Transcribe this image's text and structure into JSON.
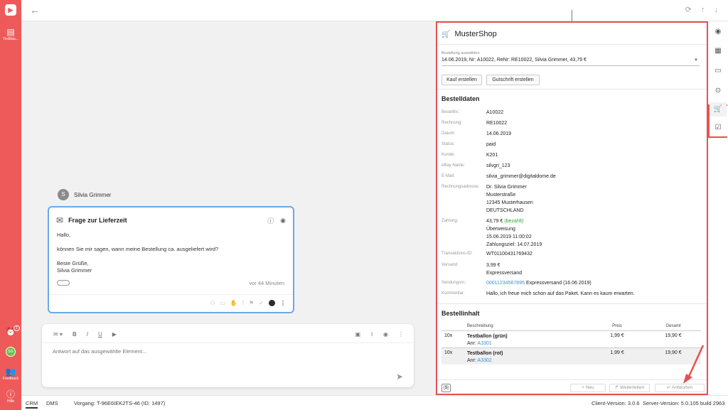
{
  "leftbar": {
    "logo": "▶",
    "textbausteine_label": "Textbau...",
    "alarm_badge": "1",
    "avatar_initials": "SG",
    "feedback_label": "Feedback",
    "help_label": "Hilfe"
  },
  "conversation": {
    "sender_initial": "S",
    "sender_name": "Silvia Grimmer",
    "message": {
      "title": "Frage zur Lieferzeit",
      "greeting": "Hallo,",
      "body": "können Sie mir sagen, wann meine Bestellung ca. ausgeliefert wird?",
      "closing": "Beste Grüße,",
      "signature": "Silvia Grimmer",
      "more": "···",
      "time": "vor 44 Minuten"
    }
  },
  "reply": {
    "placeholder": "Antwort auf das ausgewählte Element...",
    "bold": "B",
    "italic": "I",
    "underline": "U"
  },
  "shop": {
    "title": "MusterShop",
    "order_select_label": "Bestellung auswählen",
    "order_select_value": "14.06.2019, Nr: A10022, ReNr: RE10022, Silvia Grimmer, 43,79 €",
    "btn_kauf": "Kauf erstellen",
    "btn_gutschrift": "Gutschrift erstellen",
    "bestelldaten_title": "Bestelldaten",
    "fields": {
      "bestellnr_k": "Bestellnr.:",
      "bestellnr_v": "A10022",
      "rechnung_k": "Rechnung:",
      "rechnung_v": "RE10022",
      "datum_k": "Datum:",
      "datum_v": "14.06.2019",
      "status_k": "Status:",
      "status_v": "paid",
      "kunde_k": "Kunde:",
      "kunde_v": "K201",
      "ebay_k": "eBay Name:",
      "ebay_v": "silvgri_123",
      "email_k": "E-Mail:",
      "email_v": "silvia_grimmer@digitaldome.de",
      "adresse_k": "Rechnungsadresse:",
      "adresse_1": "Dr. Silvia Grimmer",
      "adresse_2": "Musterstraße",
      "adresse_3": "12345 Musterhausen",
      "adresse_4": "DEUTSCHLAND",
      "zahlung_k": "Zahlung:",
      "zahlung_betrag": "43,79 €",
      "zahlung_status": "(bezahlt)",
      "zahlung_2": "Überweisung",
      "zahlung_3": "15.06.2019 11:00:02",
      "zahlung_4": "Zahlungsziel: 14.07.2019",
      "trans_k": "Transaktions-ID:",
      "trans_v": "WT01100431769432",
      "versand_k": "Versand:",
      "versand_1": "3,99 €",
      "versand_2": "Expressversand",
      "sendung_k": "Sendungsnr.:",
      "sendung_link": "00011234567895",
      "sendung_text": "Expressversand (16.06.2019)",
      "kommentar_k": "Kommentar:",
      "kommentar_v": "Hallo, ich freue mich schon auf das Paket. Kann es kaum erwarten."
    },
    "bestellinhalt_title": "Bestellinhalt",
    "table": {
      "headers": [
        "",
        "Beschreibung",
        "Preis",
        "Gesamt"
      ],
      "rows": [
        {
          "qty": "10x",
          "name": "Testballon (grün)",
          "anr_label": "Anr:",
          "anr": "A3301",
          "price": "1,99 €",
          "total": "19,90 €"
        },
        {
          "qty": "10x",
          "name": "Testballon (rot)",
          "anr_label": "Anr:",
          "anr": "A3302",
          "price": "1,99 €",
          "total": "19,90 €"
        }
      ]
    },
    "footer": {
      "dollar": "[$]",
      "neu": "+ Neu",
      "weiterleiten": "↱ Weiterleiten",
      "antworten": "↩ Antworten"
    }
  },
  "statusbar": {
    "tab_crm": "CRM",
    "tab_dms": "DMS",
    "vorgang": "Vorgang: T-96E6IEK2TS-46 (ID: 1497)",
    "client_version": "Client-Version: 3.0.6",
    "server_version": "Server-Version: 5.0.105 build 2963"
  },
  "colors": {
    "sidebar_red": "#ee5a5a",
    "highlight_red": "#e85050",
    "link_blue": "#3b8edb",
    "paid_green": "#33a033",
    "card_border_blue": "#6aa8e8"
  }
}
